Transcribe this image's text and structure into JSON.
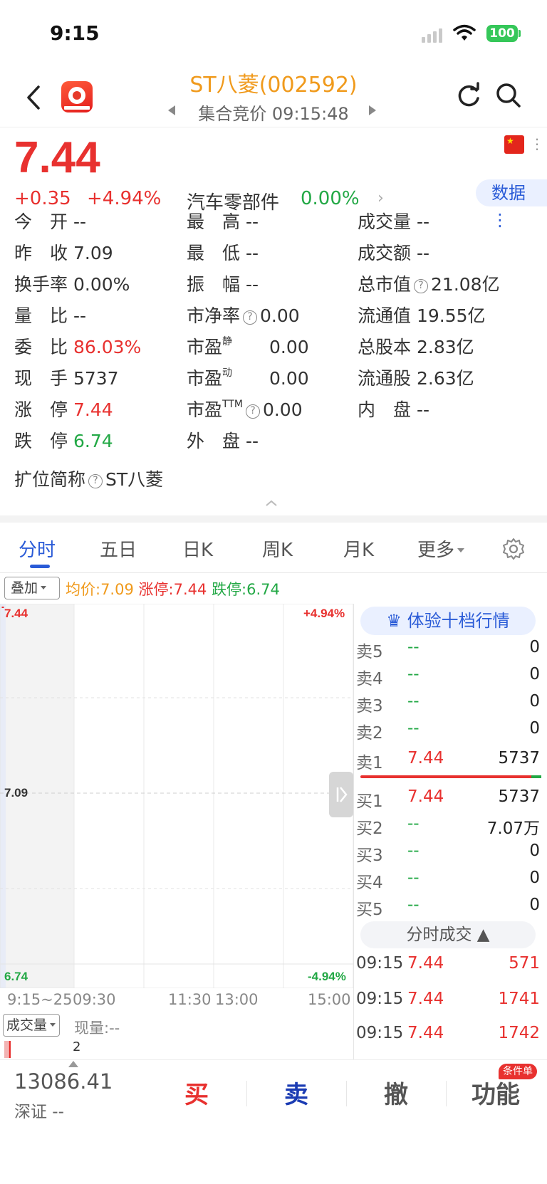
{
  "status_bar": {
    "time": "9:15",
    "battery": "100"
  },
  "header": {
    "title": "ST八菱(002592)",
    "subtitle": "集合竞价 09:15:48"
  },
  "quote": {
    "price": "7.44",
    "change": "+0.35",
    "change_pct": "+4.94%",
    "sector_name": "汽车零部件",
    "sector_pct": "0.00%",
    "data_button": "数据"
  },
  "stats": {
    "open_label": "今　开",
    "open": "--",
    "high_label": "最　高",
    "high": "--",
    "volume_label": "成交量",
    "volume": "--",
    "prev_close_label": "昨　收",
    "prev_close": "7.09",
    "low_label": "最　低",
    "low": "--",
    "amount_label": "成交额",
    "amount": "--",
    "turnover_label": "换手率",
    "turnover": "0.00%",
    "amplitude_label": "振　幅",
    "amplitude": "--",
    "mkt_cap_label": "总市值",
    "mkt_cap": "21.08亿",
    "vol_ratio_label": "量　比",
    "vol_ratio": "--",
    "pb_label": "市净率",
    "pb": "0.00",
    "float_cap_label": "流通值",
    "float_cap": "19.55亿",
    "commit_ratio_label": "委　比",
    "commit_ratio": "86.03%",
    "pe_static_label": "市盈",
    "pe_static_sup": "静",
    "pe_static": "0.00",
    "total_shares_label": "总股本",
    "total_shares": "2.83亿",
    "current_hand_label": "现　手",
    "current_hand": "5737",
    "pe_dyn_label": "市盈",
    "pe_dyn_sup": "动",
    "pe_dyn": "0.00",
    "float_shares_label": "流通股",
    "float_shares": "2.63亿",
    "limit_up_label": "涨　停",
    "limit_up": "7.44",
    "pe_ttm_label": "市盈",
    "pe_ttm_sup": "TTM",
    "pe_ttm": "0.00",
    "inner_label": "内　盘",
    "inner": "--",
    "limit_down_label": "跌　停",
    "limit_down": "6.74",
    "outer_label": "外　盘",
    "outer": "--",
    "ext_name_label": "扩位简称",
    "ext_name": "ST八菱"
  },
  "tabs": [
    "分时",
    "五日",
    "日K",
    "周K",
    "月K",
    "更多"
  ],
  "overlay": {
    "button": "叠加",
    "avg": "均价:7.09",
    "limit_up": "涨停:7.44",
    "limit_down": "跌停:6.74"
  },
  "chart": {
    "y_top": "7.44",
    "y_mid": "7.09",
    "y_bottom": "6.74",
    "pct_top": "+4.94%",
    "pct_bottom": "-4.94%",
    "times": [
      "9:15~25",
      "09:30",
      "11:30",
      "13:00",
      "15:00"
    ],
    "volume_button": "成交量",
    "volume_now": "现量:--",
    "volume_value": "2"
  },
  "order_book": {
    "experience_button": "体验十档行情",
    "asks": [
      {
        "label": "卖5",
        "price": "--",
        "qty": "0"
      },
      {
        "label": "卖4",
        "price": "--",
        "qty": "0"
      },
      {
        "label": "卖3",
        "price": "--",
        "qty": "0"
      },
      {
        "label": "卖2",
        "price": "--",
        "qty": "0"
      },
      {
        "label": "卖1",
        "price": "7.44",
        "qty": "5737"
      }
    ],
    "bids": [
      {
        "label": "买1",
        "price": "7.44",
        "qty": "5737"
      },
      {
        "label": "买2",
        "price": "--",
        "qty": "7.07万"
      },
      {
        "label": "买3",
        "price": "--",
        "qty": "0"
      },
      {
        "label": "买4",
        "price": "--",
        "qty": "0"
      },
      {
        "label": "买5",
        "price": "--",
        "qty": "0"
      }
    ],
    "trades_button": "分时成交",
    "trades": [
      {
        "time": "09:15",
        "price": "7.44",
        "qty": "571"
      },
      {
        "time": "09:15",
        "price": "7.44",
        "qty": "1741"
      },
      {
        "time": "09:15",
        "price": "7.44",
        "qty": "1742"
      }
    ]
  },
  "bottom": {
    "index_value": "13086.41",
    "index_name": "深证 --",
    "buy": "买",
    "sell": "卖",
    "cancel": "撤",
    "function": "功能",
    "badge": "条件单"
  },
  "colors": {
    "up": "#e8312f",
    "down": "#22a845",
    "accent": "#2a5bd7",
    "title": "#f09a1c"
  }
}
